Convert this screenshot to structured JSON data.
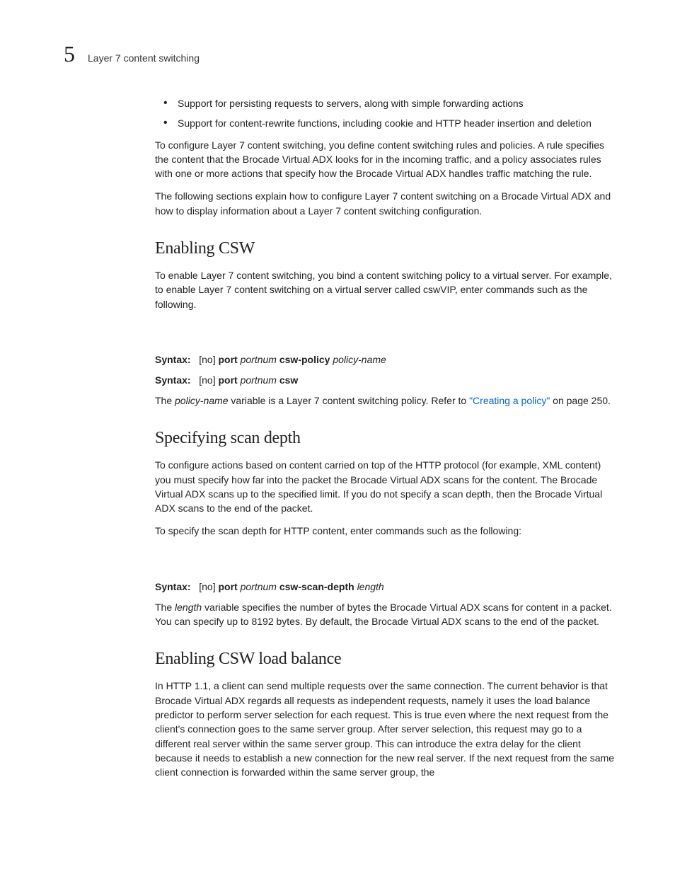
{
  "header": {
    "chapter_num": "5",
    "chapter_title": "Layer 7 content switching"
  },
  "bullets": {
    "b1": "Support for persisting requests to servers, along with simple forwarding actions",
    "b2": "Support for content-rewrite functions, including cookie and HTTP header insertion and deletion"
  },
  "intro": {
    "p1": "To configure Layer 7 content switching, you define content switching rules and policies. A rule specifies the content that the Brocade Virtual ADX looks for in the incoming traffic, and a policy associates rules with one or more actions that specify how the Brocade Virtual ADX handles traffic matching the rule.",
    "p2": "The following sections explain how to configure Layer 7 content switching on a Brocade Virtual ADX and how to display information about a Layer 7 content switching configuration."
  },
  "sec1": {
    "title": "Enabling CSW",
    "p1": "To enable Layer 7 content switching, you bind a content switching policy to a virtual server. For example, to enable Layer 7 content switching on a virtual server called cswVIP, enter commands such as the following.",
    "syntax_label": "Syntax:",
    "s1_no": "[no]",
    "s1_port": "port",
    "s1_portnum": "portnum",
    "s1_cswpol": "csw-policy",
    "s1_polname": "policy-name",
    "s2_no": "[no]",
    "s2_port": "port",
    "s2_portnum": "portnum",
    "s2_csw": "csw",
    "p2_a": "The ",
    "p2_b": "policy-name",
    "p2_c": " variable is a Layer 7 content switching policy. Refer to ",
    "p2_link": "\"Creating a policy\"",
    "p2_d": " on page 250."
  },
  "sec2": {
    "title": "Specifying scan depth",
    "p1": "To configure actions based on content carried on top of the HTTP protocol (for example, XML content) you must specify how far into the packet the Brocade Virtual ADX scans for the content. The Brocade Virtual ADX scans up to the specified limit. If you do not specify a scan depth, then the Brocade Virtual ADX scans to the end of the packet.",
    "p2": "To specify the scan depth for HTTP content, enter commands such as the following:",
    "syntax_label": "Syntax:",
    "s1_no": "[no]",
    "s1_port": "port",
    "s1_portnum": "portnum",
    "s1_scandepth": "csw-scan-depth",
    "s1_length": "length",
    "p3_a": "The ",
    "p3_b": "length",
    "p3_c": " variable specifies the number of bytes the Brocade Virtual ADX scans for content in a packet. You can specify up to 8192 bytes. By default, the Brocade Virtual ADX scans to the end of the packet."
  },
  "sec3": {
    "title": "Enabling CSW load balance",
    "p1": "In HTTP 1.1, a client can send multiple requests over the same connection. The current behavior is that Brocade Virtual ADX regards all requests as independent requests, namely it uses the load balance predictor to perform server selection for each request. This is true even where the next request from the client's connection goes to the same server group. After server selection, this request may go to a different real server within the same server group. This can introduce the extra delay for the client because it needs to establish a new connection for the new real server. If the next request from the same client connection is forwarded within the same server group, the"
  }
}
